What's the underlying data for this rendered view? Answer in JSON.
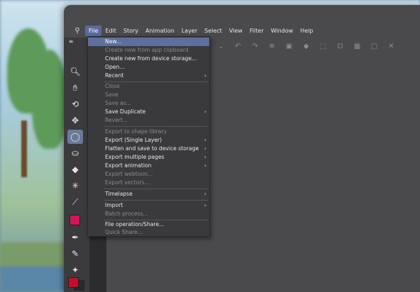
{
  "menubar": {
    "logo_icon": "app-logo-icon",
    "items": [
      "File",
      "Edit",
      "Story",
      "Animation",
      "Layer",
      "Select",
      "View",
      "Filter",
      "Window",
      "Help"
    ],
    "active_index": 0
  },
  "file_menu": {
    "items": [
      {
        "label": "New...",
        "disabled": false,
        "highlight": true,
        "submenu": false
      },
      {
        "label": "Create new from app clipboard",
        "disabled": true,
        "submenu": false
      },
      {
        "label": "Create new from device storage...",
        "disabled": false,
        "submenu": false
      },
      {
        "label": "Open...",
        "disabled": false,
        "submenu": false
      },
      {
        "label": "Recent",
        "disabled": false,
        "submenu": true
      },
      {
        "label": "Close",
        "disabled": true,
        "submenu": false
      },
      {
        "label": "Save",
        "disabled": true,
        "submenu": false
      },
      {
        "label": "Save as...",
        "disabled": true,
        "submenu": false
      },
      {
        "label": "Save Duplicate",
        "disabled": false,
        "submenu": true
      },
      {
        "label": "Revert...",
        "disabled": true,
        "submenu": false
      },
      {
        "label": "Export to shape library",
        "disabled": true,
        "submenu": false
      },
      {
        "label": "Export (Single Layer)",
        "disabled": false,
        "submenu": true
      },
      {
        "label": "Flatten and save to device storage",
        "disabled": false,
        "submenu": true
      },
      {
        "label": "Export multiple pages",
        "disabled": false,
        "submenu": true
      },
      {
        "label": "Export animation",
        "disabled": false,
        "submenu": true
      },
      {
        "label": "Export webtoon...",
        "disabled": true,
        "submenu": false
      },
      {
        "label": "Export vectors...",
        "disabled": true,
        "submenu": false
      },
      {
        "label": "Timelapse",
        "disabled": false,
        "submenu": true
      },
      {
        "label": "Import",
        "disabled": false,
        "submenu": true
      },
      {
        "label": "Batch process...",
        "disabled": true,
        "submenu": false
      },
      {
        "label": "File operation/Share...",
        "disabled": false,
        "submenu": false
      },
      {
        "label": "Quick Share...",
        "disabled": true,
        "submenu": false
      }
    ]
  },
  "tools": [
    "zoom-icon",
    "hand-icon",
    "rotate-icon",
    "move-icon",
    "lasso-icon",
    "bucket-icon",
    "eraser-icon",
    "magic-wand-icon",
    "eyedropper-icon",
    "pen-icon",
    "brush-icon",
    "sparkle-icon"
  ],
  "colors": {
    "accent": "#5c6f9d",
    "swatch_main": "#d4145a",
    "swatch_fg": "#c0102e",
    "swatch_bg": "#2a2a2a"
  }
}
